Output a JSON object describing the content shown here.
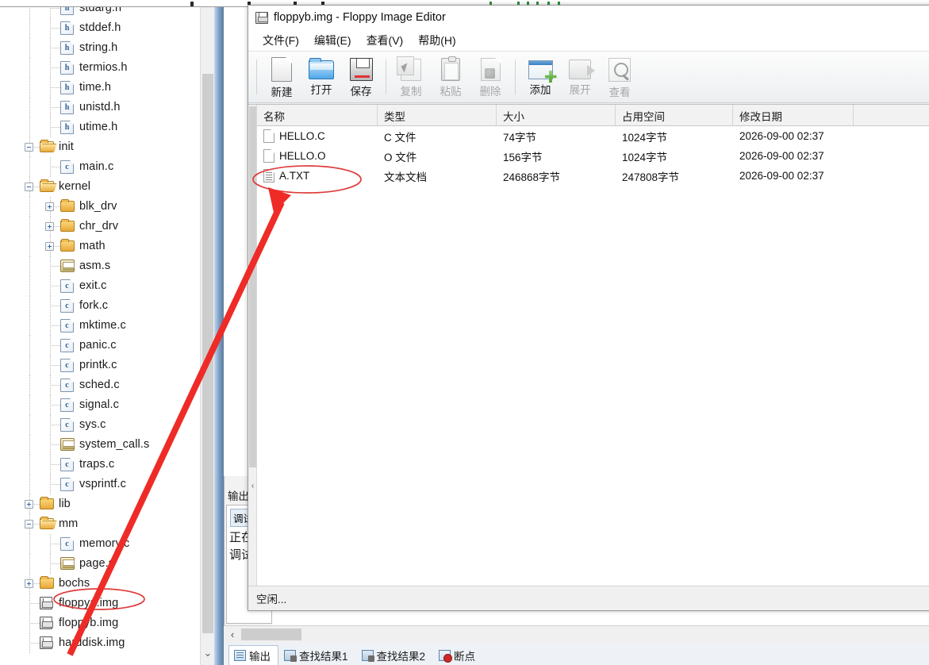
{
  "window": {
    "title": "floppyb.img - Floppy Image Editor",
    "title_icon": "floppy-disk-icon",
    "status": "空闲...",
    "menu": [
      {
        "label": "文件(F)",
        "name": "file"
      },
      {
        "label": "编辑(E)",
        "name": "edit"
      },
      {
        "label": "查看(V)",
        "name": "view"
      },
      {
        "label": "帮助(H)",
        "name": "help"
      }
    ],
    "toolbar": [
      {
        "label": "新建",
        "icon": "new-file-icon",
        "name": "new",
        "enabled": true
      },
      {
        "label": "打开",
        "icon": "open-folder-icon",
        "name": "open",
        "enabled": true
      },
      {
        "label": "保存",
        "icon": "save-disk-icon",
        "name": "save",
        "enabled": true
      },
      {
        "label": "复制",
        "icon": "copy-icon",
        "name": "copy",
        "enabled": false
      },
      {
        "label": "粘贴",
        "icon": "paste-icon",
        "name": "paste",
        "enabled": false
      },
      {
        "label": "删除",
        "icon": "delete-icon",
        "name": "delete",
        "enabled": false
      },
      {
        "label": "添加",
        "icon": "add-plus-icon",
        "name": "add",
        "enabled": true
      },
      {
        "label": "展开",
        "icon": "extract-icon",
        "name": "expand",
        "enabled": false
      },
      {
        "label": "查看",
        "icon": "magnifier-icon",
        "name": "view",
        "enabled": false
      }
    ],
    "list": {
      "columns": [
        "名称",
        "类型",
        "大小",
        "占用空间",
        "修改日期"
      ],
      "rows": [
        {
          "icon": "blank-document-icon",
          "name": "HELLO.C",
          "type": "C 文件",
          "size": "74字节",
          "used": "1024字节",
          "modified": "2026-09-00 02:37"
        },
        {
          "icon": "blank-document-icon",
          "name": "HELLO.O",
          "type": "O 文件",
          "size": "156字节",
          "used": "1024字节",
          "modified": "2026-09-00 02:37"
        },
        {
          "icon": "text-document-icon",
          "name": "A.TXT",
          "type": "文本文档",
          "size": "246868字节",
          "used": "247808字节",
          "modified": "2026-09-00 02:37"
        }
      ]
    }
  },
  "tree": {
    "items": [
      {
        "label": "stdarg.h",
        "icon": "h-file-icon",
        "indent": 2,
        "expander": ""
      },
      {
        "label": "stddef.h",
        "icon": "h-file-icon",
        "indent": 2,
        "expander": ""
      },
      {
        "label": "string.h",
        "icon": "h-file-icon",
        "indent": 2,
        "expander": ""
      },
      {
        "label": "termios.h",
        "icon": "h-file-icon",
        "indent": 2,
        "expander": ""
      },
      {
        "label": "time.h",
        "icon": "h-file-icon",
        "indent": 2,
        "expander": ""
      },
      {
        "label": "unistd.h",
        "icon": "h-file-icon",
        "indent": 2,
        "expander": ""
      },
      {
        "label": "utime.h",
        "icon": "h-file-icon",
        "indent": 2,
        "expander": ""
      },
      {
        "label": "init",
        "icon": "folder-open-icon",
        "indent": 1,
        "expander": "minus"
      },
      {
        "label": "main.c",
        "icon": "c-file-icon",
        "indent": 2,
        "expander": ""
      },
      {
        "label": "kernel",
        "icon": "folder-open-icon",
        "indent": 1,
        "expander": "minus"
      },
      {
        "label": "blk_drv",
        "icon": "folder-icon",
        "indent": 2,
        "expander": "plus"
      },
      {
        "label": "chr_drv",
        "icon": "folder-icon",
        "indent": 2,
        "expander": "plus"
      },
      {
        "label": "math",
        "icon": "folder-icon",
        "indent": 2,
        "expander": "plus"
      },
      {
        "label": "asm.s",
        "icon": "asm-file-icon",
        "indent": 2,
        "expander": ""
      },
      {
        "label": "exit.c",
        "icon": "c-file-icon",
        "indent": 2,
        "expander": ""
      },
      {
        "label": "fork.c",
        "icon": "c-file-icon",
        "indent": 2,
        "expander": ""
      },
      {
        "label": "mktime.c",
        "icon": "c-file-icon",
        "indent": 2,
        "expander": ""
      },
      {
        "label": "panic.c",
        "icon": "c-file-icon",
        "indent": 2,
        "expander": ""
      },
      {
        "label": "printk.c",
        "icon": "c-file-icon",
        "indent": 2,
        "expander": ""
      },
      {
        "label": "sched.c",
        "icon": "c-file-icon",
        "indent": 2,
        "expander": ""
      },
      {
        "label": "signal.c",
        "icon": "c-file-icon",
        "indent": 2,
        "expander": ""
      },
      {
        "label": "sys.c",
        "icon": "c-file-icon",
        "indent": 2,
        "expander": ""
      },
      {
        "label": "system_call.s",
        "icon": "asm-file-icon",
        "indent": 2,
        "expander": ""
      },
      {
        "label": "traps.c",
        "icon": "c-file-icon",
        "indent": 2,
        "expander": ""
      },
      {
        "label": "vsprintf.c",
        "icon": "c-file-icon",
        "indent": 2,
        "expander": ""
      },
      {
        "label": "lib",
        "icon": "folder-icon",
        "indent": 1,
        "expander": "plus"
      },
      {
        "label": "mm",
        "icon": "folder-open-icon",
        "indent": 1,
        "expander": "minus"
      },
      {
        "label": "memory.c",
        "icon": "c-file-icon",
        "indent": 2,
        "expander": ""
      },
      {
        "label": "page.s",
        "icon": "asm-file-icon",
        "indent": 2,
        "expander": ""
      },
      {
        "label": "bochs",
        "icon": "folder-icon",
        "indent": 1,
        "expander": "plus"
      },
      {
        "label": "floppya.img",
        "icon": "floppy-disk-icon",
        "indent": 1,
        "expander": ""
      },
      {
        "label": "floppyb.img",
        "icon": "floppy-disk-icon",
        "indent": 1,
        "expander": "",
        "highlighted": true
      },
      {
        "label": "harddisk.img",
        "icon": "floppy-disk-icon",
        "indent": 1,
        "expander": ""
      }
    ],
    "scroll_down_glyph": "⌄"
  },
  "background_dock": {
    "title": "输出",
    "tab": "调试",
    "lines": [
      "正在",
      "调试"
    ]
  },
  "bottom": {
    "scroll_left_glyph": "‹",
    "tabs": [
      {
        "label": "输出",
        "icon": "output-icon",
        "active": true
      },
      {
        "label": "查找结果1",
        "icon": "find-results-icon",
        "active": false
      },
      {
        "label": "查找结果2",
        "icon": "find-results-icon",
        "active": false
      },
      {
        "label": "断点",
        "icon": "breakpoint-icon",
        "active": false
      }
    ]
  },
  "annotations": {
    "ellipse_file_color": "#e03b3b",
    "ellipse_tree_color": "#e03b3b",
    "arrow_color": "#ee2b26"
  }
}
